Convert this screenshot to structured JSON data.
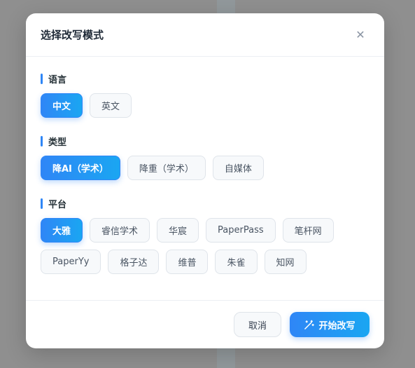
{
  "modal": {
    "title": "选择改写模式",
    "close_symbol": "✕"
  },
  "sections": {
    "language": {
      "title": "语言",
      "options": [
        "中文",
        "英文"
      ],
      "selected": "中文"
    },
    "type": {
      "title": "类型",
      "options": [
        "降AI（学术）",
        "降重（学术）",
        "自媒体"
      ],
      "selected": "降AI（学术）"
    },
    "platform": {
      "title": "平台",
      "options": [
        "大雅",
        "睿信学术",
        "华宸",
        "PaperPass",
        "笔杆网",
        "PaperYy",
        "格子达",
        "维普",
        "朱雀",
        "知网"
      ],
      "selected": "大雅"
    }
  },
  "footer": {
    "cancel_label": "取消",
    "start_label": "开始改写",
    "start_icon": "magic-wand-icon"
  },
  "colors": {
    "accent": "#2f86f6",
    "accent_end": "#1aa6f2",
    "backdrop": "#8f8f8f"
  }
}
